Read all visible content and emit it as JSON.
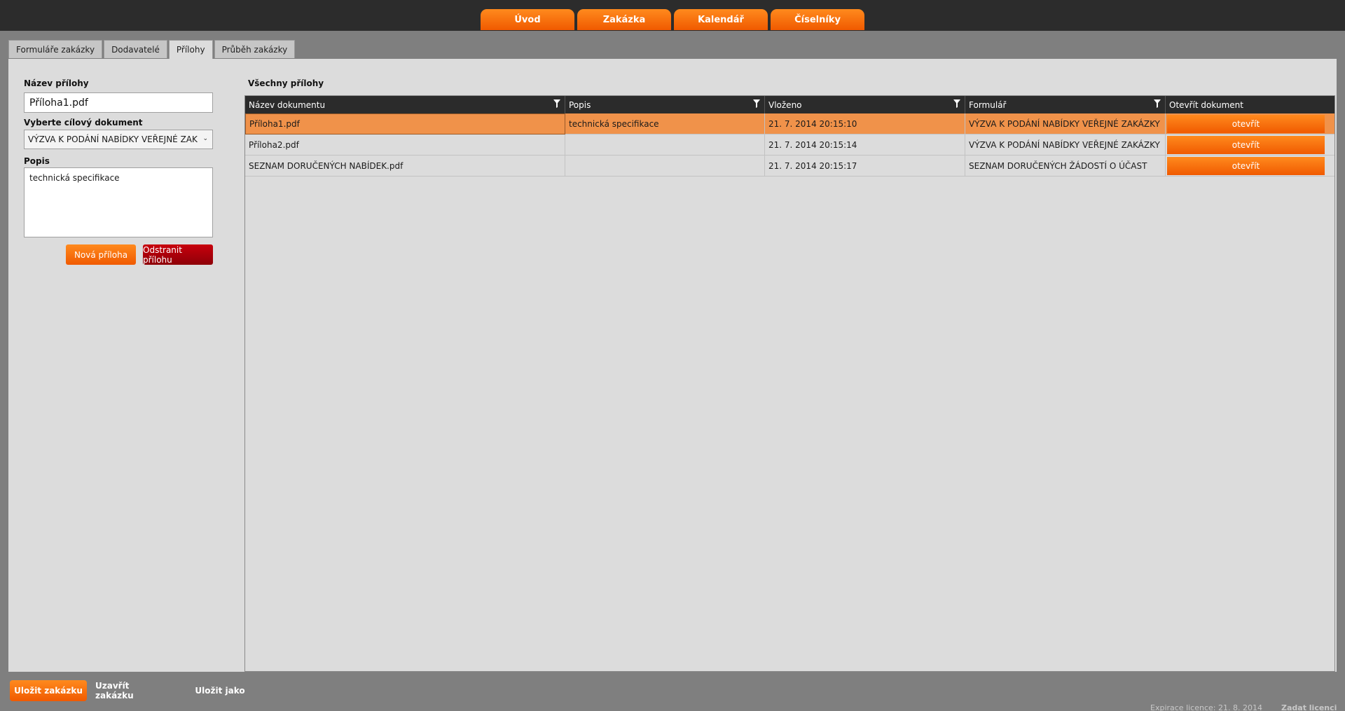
{
  "topnav": [
    "Úvod",
    "Zakázka",
    "Kalendář",
    "Číselníky"
  ],
  "subtabs": [
    "Formuláře zakázky",
    "Dodavatelé",
    "Přílohy",
    "Průběh zakázky"
  ],
  "form": {
    "name_label": "Název přílohy",
    "name_value": "Příloha1.pdf",
    "target_label": "Vyberte cílový dokument",
    "target_value": "VÝZVA K PODÁNÍ NABÍDKY VEŘEJNÉ ZAK",
    "desc_label": "Popis",
    "desc_value": "technická specifikace",
    "new_button": "Nová příloha",
    "remove_button": "Odstranit přílohu"
  },
  "grid": {
    "title": "Všechny přílohy",
    "columns": [
      "Název dokumentu",
      "Popis",
      "Vloženo",
      "Formulář",
      "Otevřít dokument"
    ],
    "rows": [
      {
        "name": "Příloha1.pdf",
        "desc": "technická specifikace",
        "date": "21. 7. 2014 20:15:10",
        "form": "VÝZVA K PODÁNÍ NABÍDKY VEŘEJNÉ ZAKÁZKY",
        "action": "otevřít"
      },
      {
        "name": "Příloha2.pdf",
        "desc": "",
        "date": "21. 7. 2014 20:15:14",
        "form": "VÝZVA K PODÁNÍ NABÍDKY VEŘEJNÉ ZAKÁZKY",
        "action": "otevřít"
      },
      {
        "name": "SEZNAM DORUČENÝCH NABÍDEK.pdf",
        "desc": "",
        "date": "21. 7. 2014 20:15:17",
        "form": "SEZNAM DORUČENÝCH ŽÁDOSTÍ O ÚČAST",
        "action": "otevřít"
      }
    ]
  },
  "bottom": {
    "save": "Uložit zakázku",
    "close": "Uzavřít zakázku",
    "save_as": "Uložit jako",
    "license_text": "Expirace licence: 21. 8. 2014",
    "license_link": "Zadat licenci"
  },
  "colors": {
    "accent": "#f26a0f",
    "danger": "#a1000a",
    "selected_row": "#f0924a",
    "topbar": "#2c2c2c"
  }
}
